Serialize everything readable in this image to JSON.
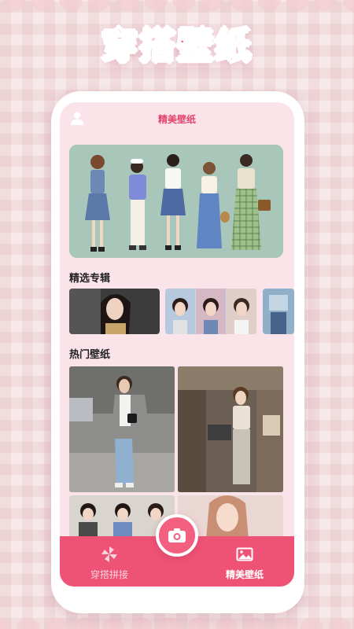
{
  "promo": {
    "title": "穿搭壁纸"
  },
  "header": {
    "title": "精美壁纸",
    "user_icon": "user-icon"
  },
  "sections": {
    "albums_title": "精选专辑",
    "hot_title": "热门壁纸"
  },
  "tabs": [
    {
      "label": "穿搭拼接",
      "icon": "pinwheel-icon",
      "active": false
    },
    {
      "label": "精美壁纸",
      "icon": "image-icon",
      "active": true
    }
  ],
  "fab": {
    "icon": "camera-icon"
  },
  "colors": {
    "accent": "#ee5274",
    "screen_bg": "#fbe3ea",
    "title_pink": "#f25078"
  }
}
